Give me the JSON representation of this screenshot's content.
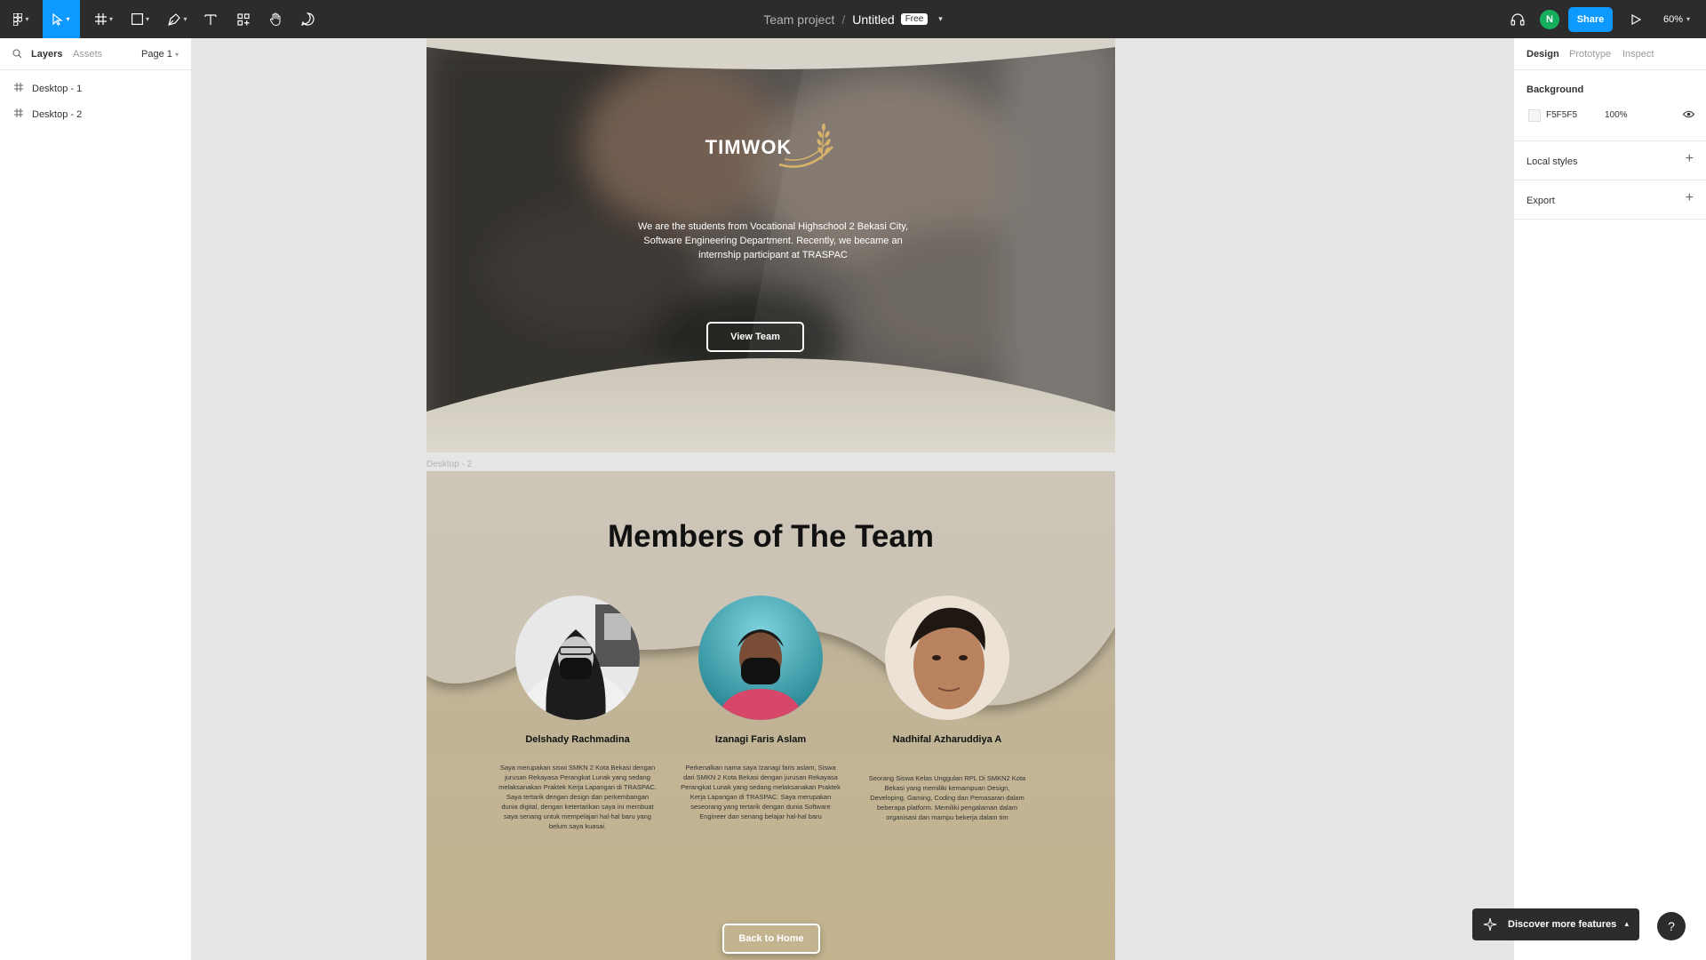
{
  "toolbar": {
    "breadcrumb": {
      "team": "Team project",
      "separator": "/",
      "file": "Untitled",
      "badge": "Free"
    },
    "avatar_initial": "N",
    "share_label": "Share",
    "zoom_label": "60%"
  },
  "left_panel": {
    "tabs": [
      "Layers",
      "Assets"
    ],
    "page_label": "Page 1",
    "layers": [
      "Desktop - 1",
      "Desktop - 2"
    ]
  },
  "right_panel": {
    "tabs": [
      "Design",
      "Prototype",
      "Inspect"
    ],
    "background": {
      "title": "Background",
      "hex": "F5F5F5",
      "opacity": "100%",
      "color": "#F5F5F5"
    },
    "local_styles": "Local styles",
    "export": "Export"
  },
  "canvas": {
    "frame2_label": "Desktop - 2",
    "hero": {
      "logo": "TIMWOK",
      "description": "We are the  students from Vocational Highschool 2 Bekasi City, Software Engineering Department. Recently, we became an internship participant at TRASPAC",
      "button": "View Team"
    },
    "team": {
      "title": "Members of The Team",
      "members": [
        {
          "name": "Delshady Rachmadina",
          "description": "Saya merupakan siswi SMKN 2 Kota Bekasi dengan jurusan Rekayasa Perangkat Lunak yang sedang melaksanakan Praktek Kerja Lapangan di TRASPAC. Saya tertarik dengan design dan perkembangan dunia digital, dengan ketertarikan saya ini membuat saya senang untuk mempelajari hal-hal baru yang belum saya kuasai."
        },
        {
          "name": "Izanagi Faris Aslam",
          "description": "Perkenalkan nama saya Izanagi faris aslam, Siswa dari SMKN 2 Kota Bekasi dengan jurusan Rekayasa Perangkat Lunak yang sedang melaksanakan Praktek Kerja Lapangan di TRASPAC. Saya merupakan seseorang yang tertarik dengan dunia Software Engineer dan senang belajar hal-hal baru"
        },
        {
          "name": "Nadhifal Azharuddiya A",
          "description": "Seorang Siswa Kelas Unggulan RPL Di SMKN2 Kota Bekasi yang memiliki kemampuan Design, Developing, Gaming, Coding dan Pemasaran dalam beberapa platform. Memiliki pengalaman dalam organisasi dan mampu bekerja dalam tim"
        }
      ],
      "button": "Back to Home"
    }
  },
  "overlay": {
    "discover_label": "Discover more features",
    "help_label": "?"
  },
  "colors": {
    "toolbar": "#2c2c2c",
    "accent": "#0d99ff",
    "avatar": "#14ae5c",
    "team_bg": "#c2b38e"
  }
}
